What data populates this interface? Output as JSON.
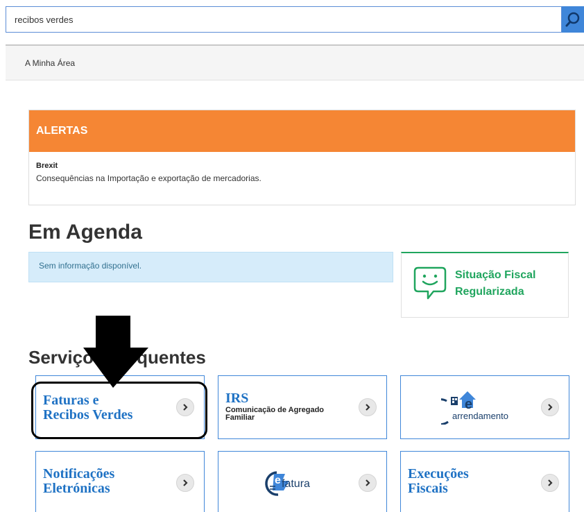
{
  "search": {
    "value": "recibos verdes"
  },
  "topbar": {
    "link": "A Minha Área"
  },
  "alerts": {
    "title": "ALERTAS",
    "item_title": "Brexit",
    "item_text": "Consequências na Importação e exportação de mercadorias."
  },
  "agenda": {
    "title": "Em Agenda",
    "empty_text": "Sem informação disponível."
  },
  "fiscal": {
    "line1": "Situação Fiscal",
    "line2": "Regularizada"
  },
  "services": {
    "title": "Serviços Frequentes",
    "cards": [
      {
        "line1": "Faturas e",
        "line2": "Recibos Verdes"
      },
      {
        "title": "IRS",
        "sub_line1": "Comunicação de Agregado",
        "sub_line2": "Familiar"
      },
      {
        "logo_text": "arrendamento",
        "logo_letter": "e"
      },
      {
        "line1": "Notificações",
        "line2": "Eletrónicas"
      },
      {
        "logo_text": "fatura",
        "logo_letter": "e"
      },
      {
        "line1": "Execuções",
        "line2": "Fiscais"
      }
    ]
  },
  "colors": {
    "accent_blue": "#3f86d9",
    "alert_orange": "#f58634",
    "success_green": "#20a55e",
    "info_bg": "#d6ecfa"
  },
  "icons": [
    "search-icon",
    "speech-smiley-icon",
    "chevron-right-icon",
    "house-logo-icon",
    "efatura-logo-icon",
    "down-arrow-annotation"
  ]
}
